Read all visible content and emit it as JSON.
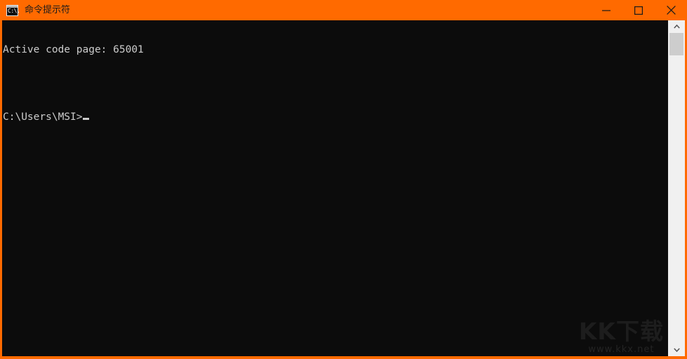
{
  "window": {
    "title": "命令提示符",
    "icon_name": "cmd-icon",
    "icon_glyph": "C:\\.",
    "titlebar_color": "#ff6a00",
    "console_background": "#0c0c0c",
    "console_foreground": "#cccccc"
  },
  "controls": {
    "minimize_label": "—",
    "maximize_label": "□",
    "close_label": "✕"
  },
  "console": {
    "lines": [
      "Active code page: 65001",
      "",
      "C:\\Users\\MSI>"
    ],
    "line1": "Active code page: 65001",
    "line2": "",
    "prompt": "C:\\Users\\MSI>"
  },
  "scrollbar": {
    "up_arrow": "▲",
    "down_arrow": "▼"
  },
  "watermark": {
    "logo": "KK下载",
    "url": "www.kkx.net"
  }
}
